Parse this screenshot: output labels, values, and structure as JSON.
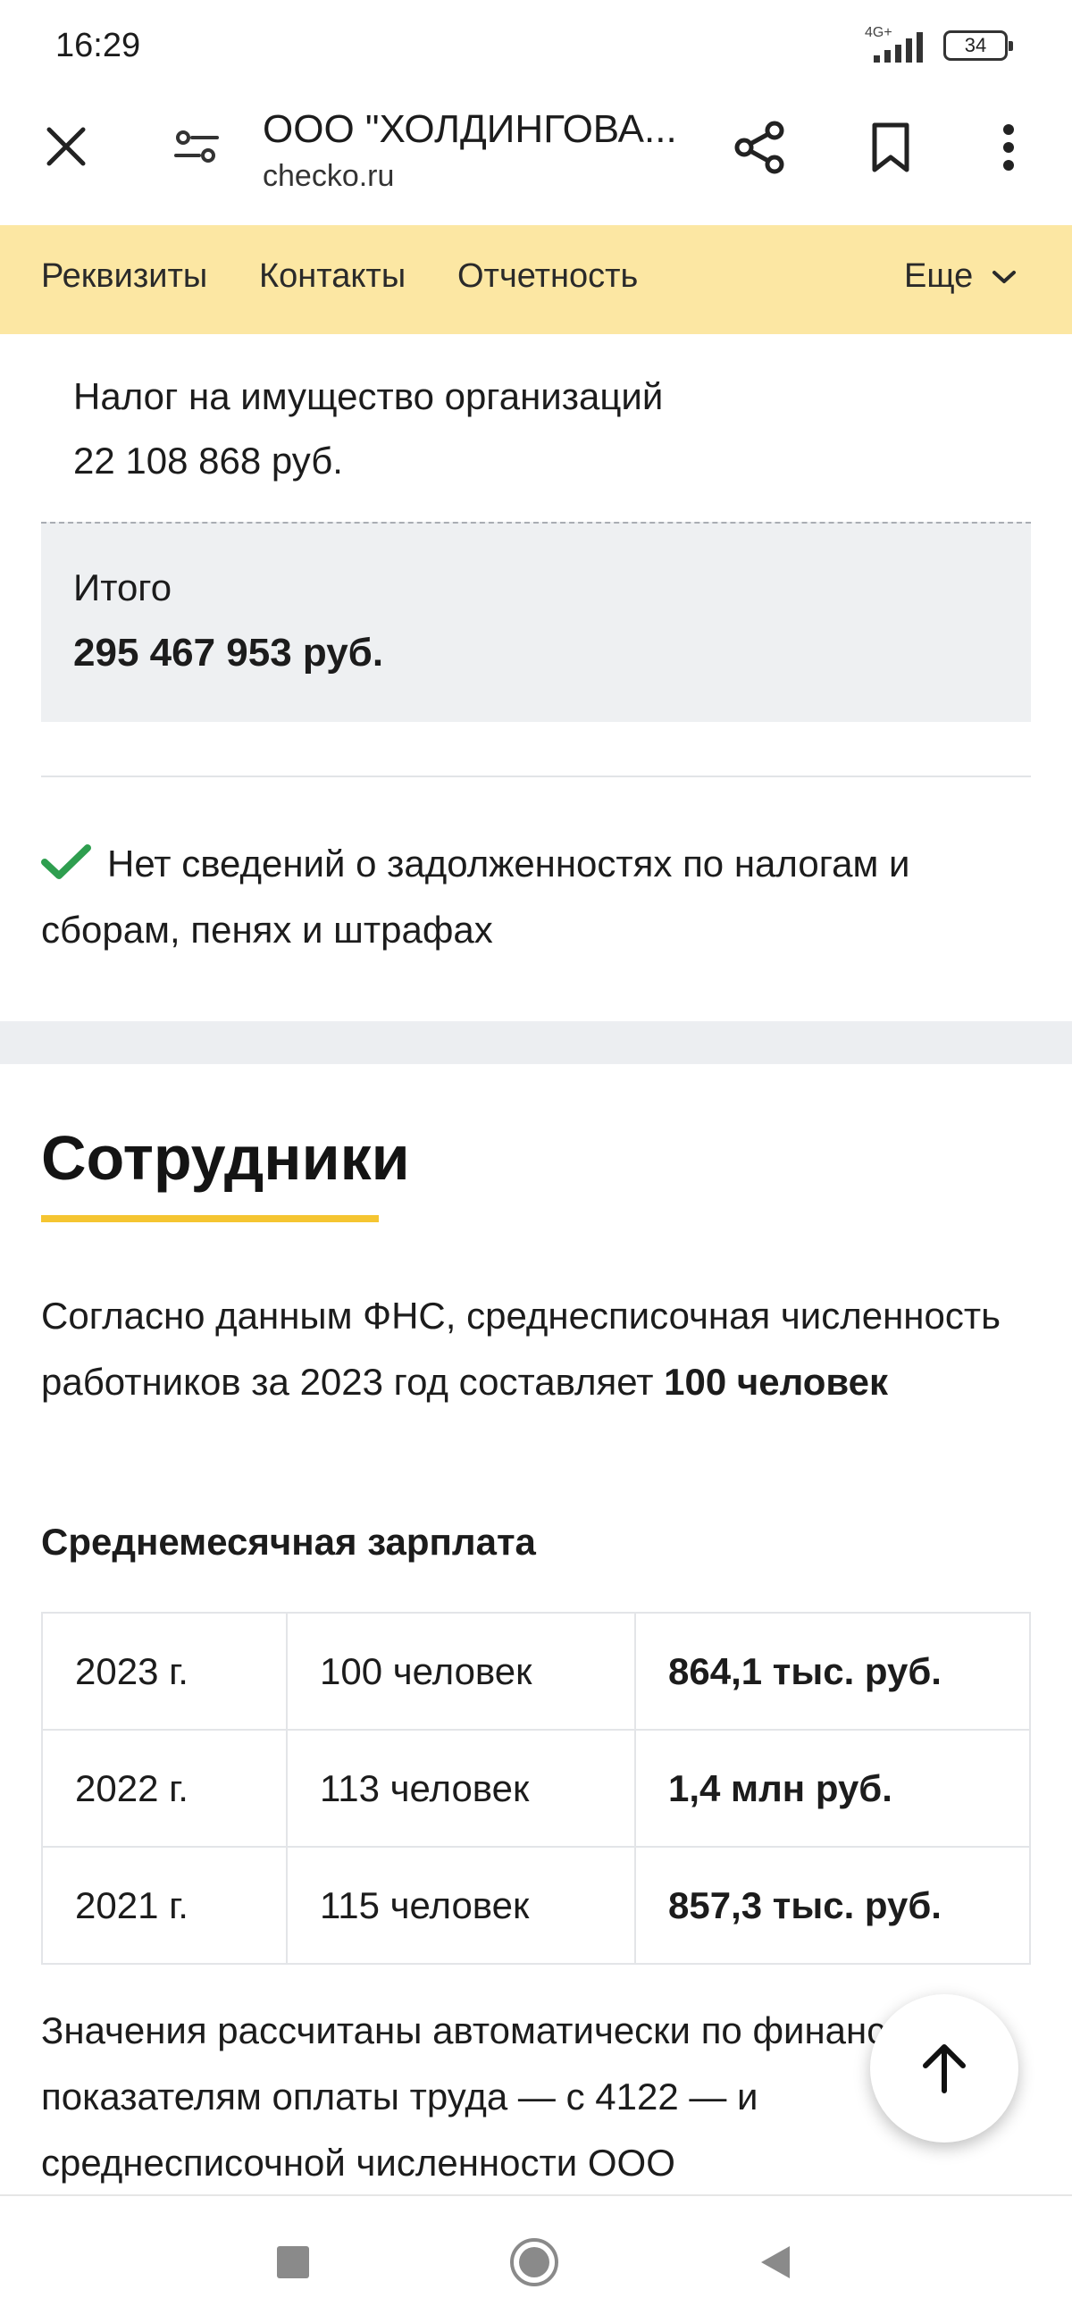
{
  "status_bar": {
    "time": "16:29",
    "network": "4G+",
    "battery": "34"
  },
  "browser": {
    "title": "ООО \"ХОЛДИНГОВА...",
    "url": "checko.ru"
  },
  "nav": {
    "items": [
      "Реквизиты",
      "Контакты",
      "Отчетность"
    ],
    "more": "Еще"
  },
  "taxes": {
    "last_item_name": "Налог на имущество организаций",
    "last_item_value": "22 108 868 руб.",
    "total_label": "Итого",
    "total_value": "295 467 953 руб.",
    "no_debt": "Нет сведений о задолженностях по налогам и сборам, пенях и штрафах"
  },
  "employees": {
    "title": "Сотрудники",
    "desc_text": "Согласно данным ФНС, среднесписочная численность работников за 2023 год составляет",
    "desc_bold": "100 человек",
    "salary_heading": "Среднемесячная зарплата",
    "rows": [
      {
        "year": "2023 г.",
        "count": "100 человек",
        "salary": "864,1 тыс. руб."
      },
      {
        "year": "2022 г.",
        "count": "113 человек",
        "salary": "1,4 млн руб."
      },
      {
        "year": "2021 г.",
        "count": "115 человек",
        "salary": "857,3 тыс. руб."
      }
    ],
    "footnote": "Значения рассчитаны автоматически по финансовым показателям оплаты труда — с 4122 — и среднесписочной численности ООО"
  },
  "colors": {
    "nav_bg": "#fce7a3",
    "accent": "#f5c531",
    "check": "#2e9e4f",
    "total_bg": "#eef0f2"
  }
}
